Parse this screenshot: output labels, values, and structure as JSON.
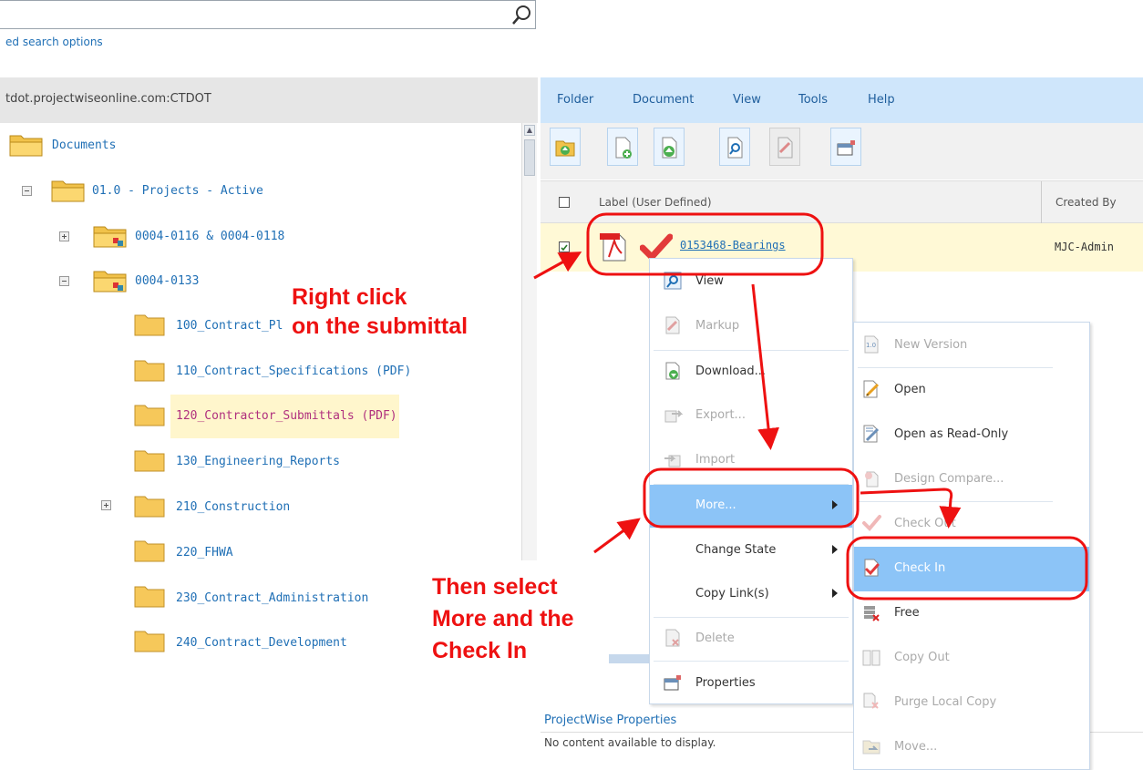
{
  "search": {
    "placeholder": "",
    "advanced_link": "ed search options"
  },
  "tree": {
    "header": "tdot.projectwiseonline.com:CTDOT",
    "items": [
      {
        "label": "Documents"
      },
      {
        "label": "01.0 - Projects - Active"
      },
      {
        "label": "0004-0116 & 0004-0118"
      },
      {
        "label": "0004-0133"
      },
      {
        "label": "100_Contract_Pl"
      },
      {
        "label": "110_Contract_Specifications (PDF)"
      },
      {
        "label": "120_Contractor_Submittals (PDF)"
      },
      {
        "label": "130_Engineering_Reports"
      },
      {
        "label": "210_Construction"
      },
      {
        "label": "220_FHWA"
      },
      {
        "label": "230_Contract_Administration"
      },
      {
        "label": "240_Contract_Development"
      }
    ]
  },
  "menubar": {
    "folder": "Folder",
    "document": "Document",
    "view": "View",
    "tools": "Tools",
    "help": "Help"
  },
  "grid": {
    "columns": {
      "label": "Label (User Defined)",
      "created_by": "Created By"
    },
    "row": {
      "label": "0153468-Bearings",
      "created_by": "MJC-Admin"
    }
  },
  "context_menu": {
    "items": [
      {
        "label": "View",
        "icon": "view-icon",
        "disabled": false
      },
      {
        "label": "Markup",
        "icon": "markup-icon",
        "disabled": true
      },
      {
        "label": "Download...",
        "icon": "download-icon",
        "disabled": false
      },
      {
        "label": "Export...",
        "icon": "export-icon",
        "disabled": true
      },
      {
        "label": "Import",
        "icon": "import-icon",
        "disabled": true
      },
      {
        "label": "More...",
        "icon": "",
        "disabled": false
      },
      {
        "label": "Change State",
        "icon": "",
        "disabled": false
      },
      {
        "label": "Copy Link(s)",
        "icon": "",
        "disabled": false
      },
      {
        "label": "Delete",
        "icon": "delete-icon",
        "disabled": true
      },
      {
        "label": "Properties",
        "icon": "properties-icon",
        "disabled": false
      }
    ]
  },
  "sub_menu": {
    "items": [
      {
        "label": "New Version",
        "icon": "new-version-icon",
        "disabled": true
      },
      {
        "label": "Open",
        "icon": "open-icon",
        "disabled": false
      },
      {
        "label": "Open as Read-Only",
        "icon": "open-read-only-icon",
        "disabled": false
      },
      {
        "label": "Design Compare...",
        "icon": "design-compare-icon",
        "disabled": true
      },
      {
        "label": "Check Out",
        "icon": "check-out-icon",
        "disabled": true
      },
      {
        "label": "Check In",
        "icon": "check-in-icon",
        "disabled": false
      },
      {
        "label": "Free",
        "icon": "free-icon",
        "disabled": false
      },
      {
        "label": "Copy Out",
        "icon": "copy-out-icon",
        "disabled": true
      },
      {
        "label": "Purge Local Copy",
        "icon": "purge-icon",
        "disabled": true
      },
      {
        "label": "Move...",
        "icon": "move-icon",
        "disabled": true
      }
    ]
  },
  "properties_panel": {
    "title": "ProjectWise Properties",
    "empty_text": "No content available to display."
  },
  "annotations": {
    "right_click_1": "Right click",
    "right_click_2": "on the submittal",
    "then_select_1": "Then select",
    "then_select_2": "More and the",
    "then_select_3": "Check In"
  },
  "colors": {
    "annotation_red": "#ee1111",
    "highlight_blue": "#8cc4f7",
    "menubar_blue": "#cfe6fb",
    "selected_row": "#fff9d6",
    "link_blue": "#1f6fb5"
  }
}
